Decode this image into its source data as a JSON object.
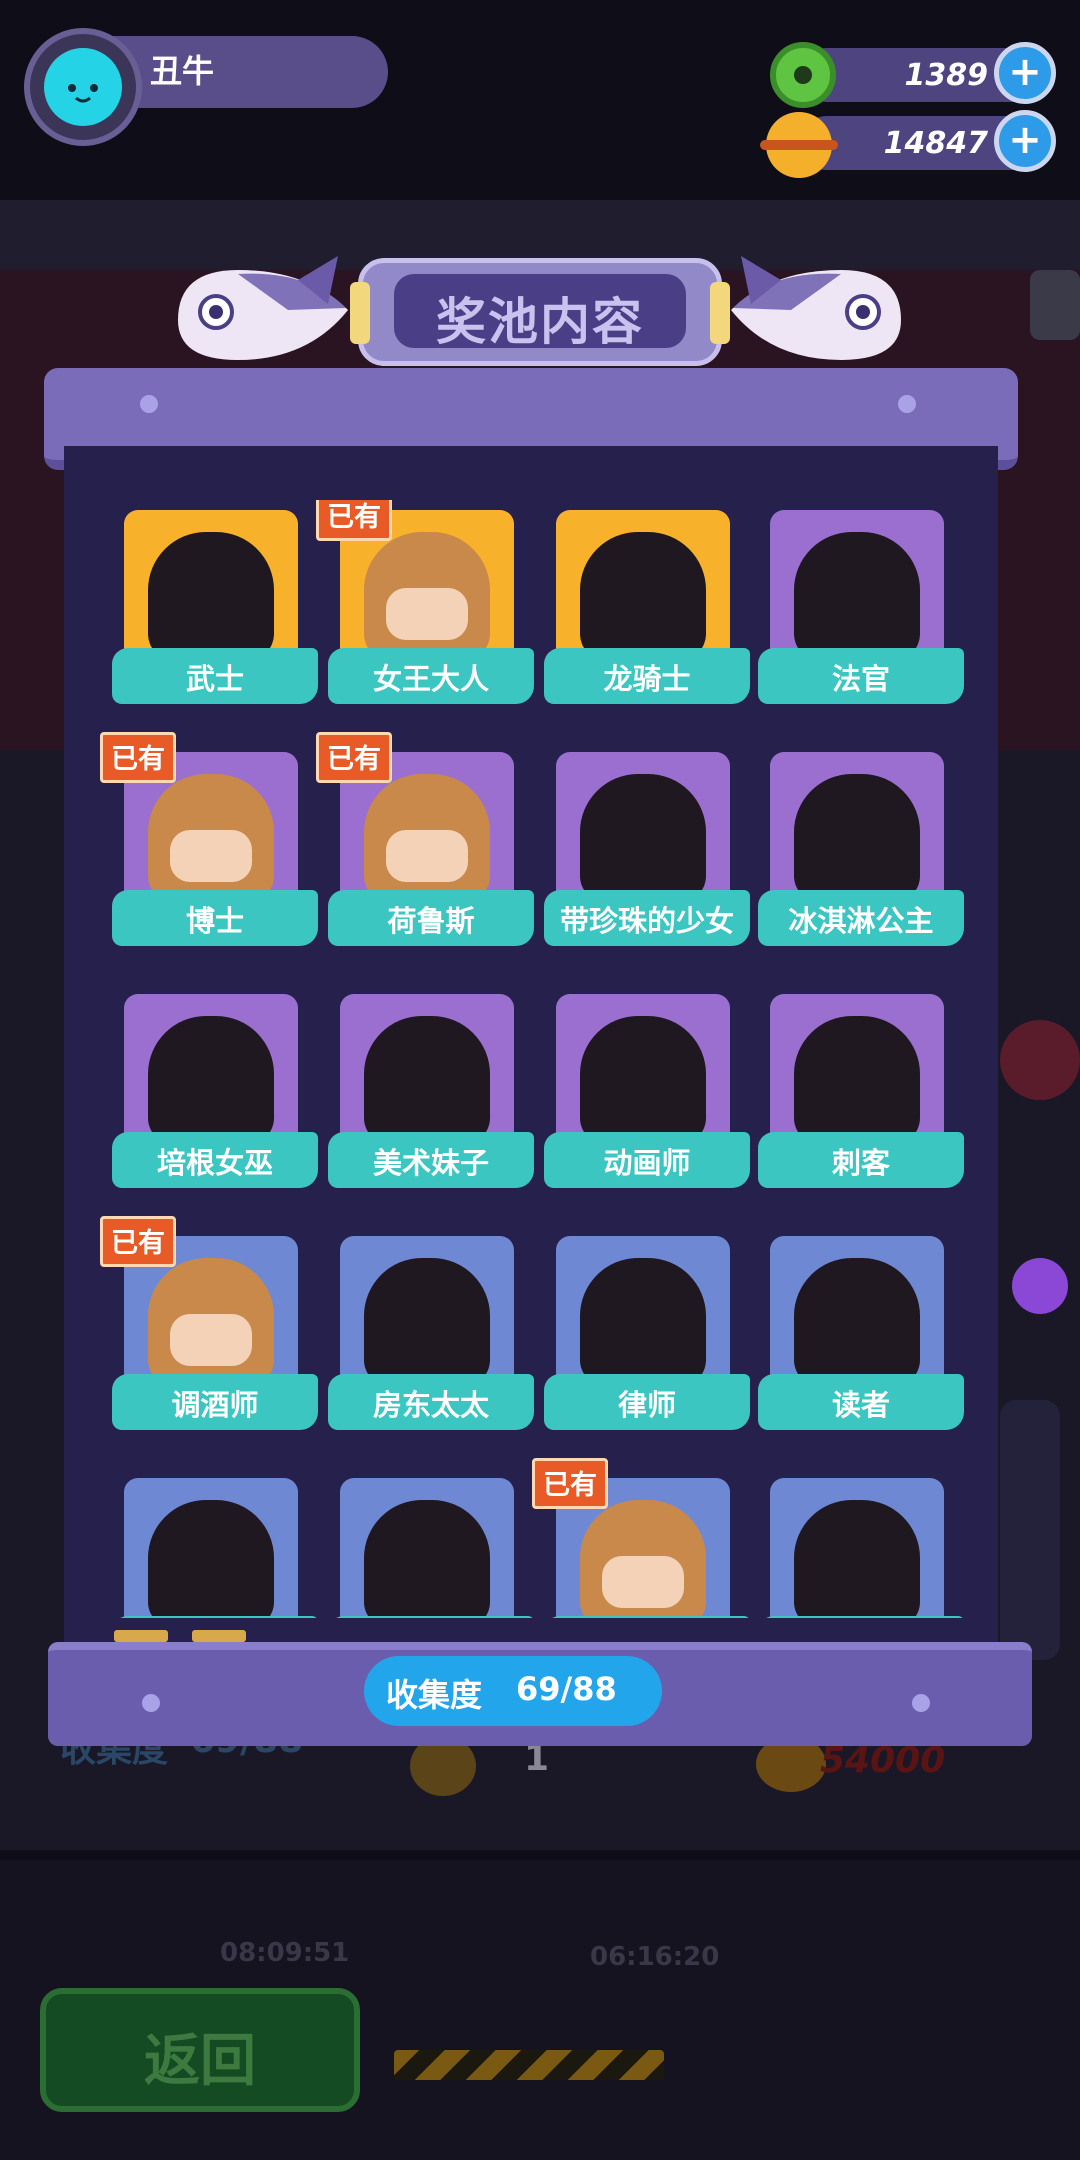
{
  "player": {
    "name": "丑牛"
  },
  "currencies": [
    {
      "icon": "green-donut-icon",
      "value": "1389",
      "color": "#5fc442"
    },
    {
      "icon": "planet-coin-icon",
      "value": "14847",
      "color": "#f4b02a"
    }
  ],
  "modal": {
    "title": "奖池内容",
    "owned_badge": "已有",
    "items": [
      {
        "name": "武士",
        "owned": false,
        "tier": "gold"
      },
      {
        "name": "女王大人",
        "owned": true,
        "tier": "gold"
      },
      {
        "name": "龙骑士",
        "owned": false,
        "tier": "gold"
      },
      {
        "name": "法官",
        "owned": false,
        "tier": "purple"
      },
      {
        "name": "博士",
        "owned": true,
        "tier": "purple"
      },
      {
        "name": "荷鲁斯",
        "owned": true,
        "tier": "purple"
      },
      {
        "name": "带珍珠的少女",
        "owned": false,
        "tier": "purple"
      },
      {
        "name": "冰淇淋公主",
        "owned": false,
        "tier": "purple"
      },
      {
        "name": "培根女巫",
        "owned": false,
        "tier": "purple"
      },
      {
        "name": "美术妹子",
        "owned": false,
        "tier": "purple"
      },
      {
        "name": "动画师",
        "owned": false,
        "tier": "purple"
      },
      {
        "name": "刺客",
        "owned": false,
        "tier": "purple"
      },
      {
        "name": "调酒师",
        "owned": true,
        "tier": "blue"
      },
      {
        "name": "房东太太",
        "owned": false,
        "tier": "blue"
      },
      {
        "name": "律师",
        "owned": false,
        "tier": "blue"
      },
      {
        "name": "读者",
        "owned": false,
        "tier": "blue"
      },
      {
        "name": "",
        "owned": false,
        "tier": "blue"
      },
      {
        "name": "",
        "owned": false,
        "tier": "blue"
      },
      {
        "name": "",
        "owned": true,
        "tier": "blue"
      },
      {
        "name": "",
        "owned": false,
        "tier": "blue"
      }
    ],
    "collection_label": "收集度",
    "collection_value": "69/88"
  },
  "background": {
    "collection_label": "收集度",
    "collection_value": "69/88",
    "count": "1",
    "coins": "54000",
    "timer_1": "08:09:51",
    "timer_2": "06:16:20",
    "back_label": "返回"
  }
}
